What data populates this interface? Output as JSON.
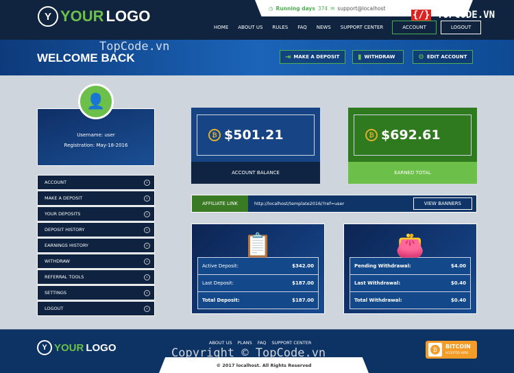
{
  "header": {
    "logo_a": "YOUR",
    "logo_b": "LOGO",
    "running_label": "Running days",
    "running_days": "374",
    "email": "support@localhost",
    "nav": [
      "HOME",
      "ABOUT US",
      "RULES",
      "FAQ",
      "NEWS",
      "SUPPORT CENTER"
    ],
    "account": "ACCOUNT",
    "logout": "LOGOUT"
  },
  "banner": {
    "title": "WELCOME BACK",
    "buttons": [
      "MAKE A DEPOSIT",
      "WITHDRAW",
      "EDIT ACCOUNT"
    ]
  },
  "profile": {
    "username": "Username: user",
    "registration": "Registration: May-18-2016"
  },
  "sidebar": {
    "items": [
      "ACCOUNT",
      "MAKE A DEPOSIT",
      "YOUR DEPOSITS",
      "DEPOSIT HISTORY",
      "EARNINGS HISTORY",
      "WITHDRAW",
      "REFERRAL TOOLS",
      "SETTINGS",
      "LOGOUT"
    ]
  },
  "balance": {
    "value": "$501.21",
    "label": "ACCOUNT BALANCE",
    "color": "#0f3468"
  },
  "earned": {
    "value": "$692.61",
    "label": "EARNED TOTAL",
    "color": "#3a8a26"
  },
  "affiliate": {
    "label": "AFFILIATE LINK",
    "url": "http://localhost/template2016/?ref=user",
    "button": "VIEW BANNERS"
  },
  "deposits": [
    {
      "label": "Active Deposit:",
      "value": "$342.00"
    },
    {
      "label": "Last Deposit:",
      "value": "$187.00"
    },
    {
      "label": "Total Deposit:",
      "value": "$187.00"
    }
  ],
  "withdrawals": [
    {
      "label": "Pending Withdrawal:",
      "value": "$4.00"
    },
    {
      "label": "Last Withdrawal:",
      "value": "$0.40"
    },
    {
      "label": "Total Withdrawal:",
      "value": "$0.40"
    }
  ],
  "footer": {
    "nav": [
      "ABOUT US",
      "PLANS",
      "FAQ",
      "SUPPORT CENTER"
    ],
    "copyright": "© 2017 localhost. All Rights Reserved",
    "bitcoin": "BITCOIN",
    "bitcoin_sub": "ACCEPTED HERE"
  },
  "watermarks": {
    "topcode": "TOPCODE.VN",
    "topcode_banner": "TopCode.vn",
    "copyright": "Copyright © TopCode.vn"
  }
}
